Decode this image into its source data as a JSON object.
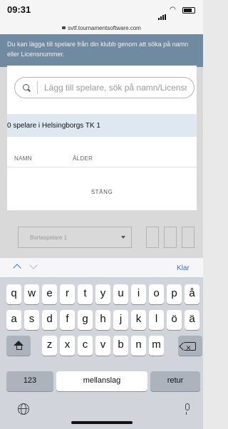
{
  "status_bar": {
    "time": "09:31",
    "url": "svtf.tournamentsoftware.com"
  },
  "background": {
    "info_text": "Du kan lägga till spelare från din klubb genom att söka på namn eller Licensnummer.",
    "select_label": "Bortaspelare 1"
  },
  "modal": {
    "search_placeholder": "Lägg till spelare, sök på namn/Licensnummer",
    "count_text": "0 spelare i Helsingborgs TK 1",
    "col_name": "NAMN",
    "col_age": "ÅLDER",
    "close_label": "STÄNG"
  },
  "keyboard": {
    "done_label": "Klar",
    "row1": [
      "q",
      "w",
      "e",
      "r",
      "t",
      "y",
      "u",
      "i",
      "o",
      "p",
      "å"
    ],
    "row2": [
      "a",
      "s",
      "d",
      "f",
      "g",
      "h",
      "j",
      "k",
      "l",
      "ö",
      "ä"
    ],
    "row3": [
      "z",
      "x",
      "c",
      "v",
      "b",
      "n",
      "m"
    ],
    "numbers_label": "123",
    "space_label": "mellanslag",
    "return_label": "retur"
  },
  "colors": {
    "accent": "#1a7cf0",
    "info_band": "#6f8aa1",
    "count_band": "#dde8f1"
  }
}
